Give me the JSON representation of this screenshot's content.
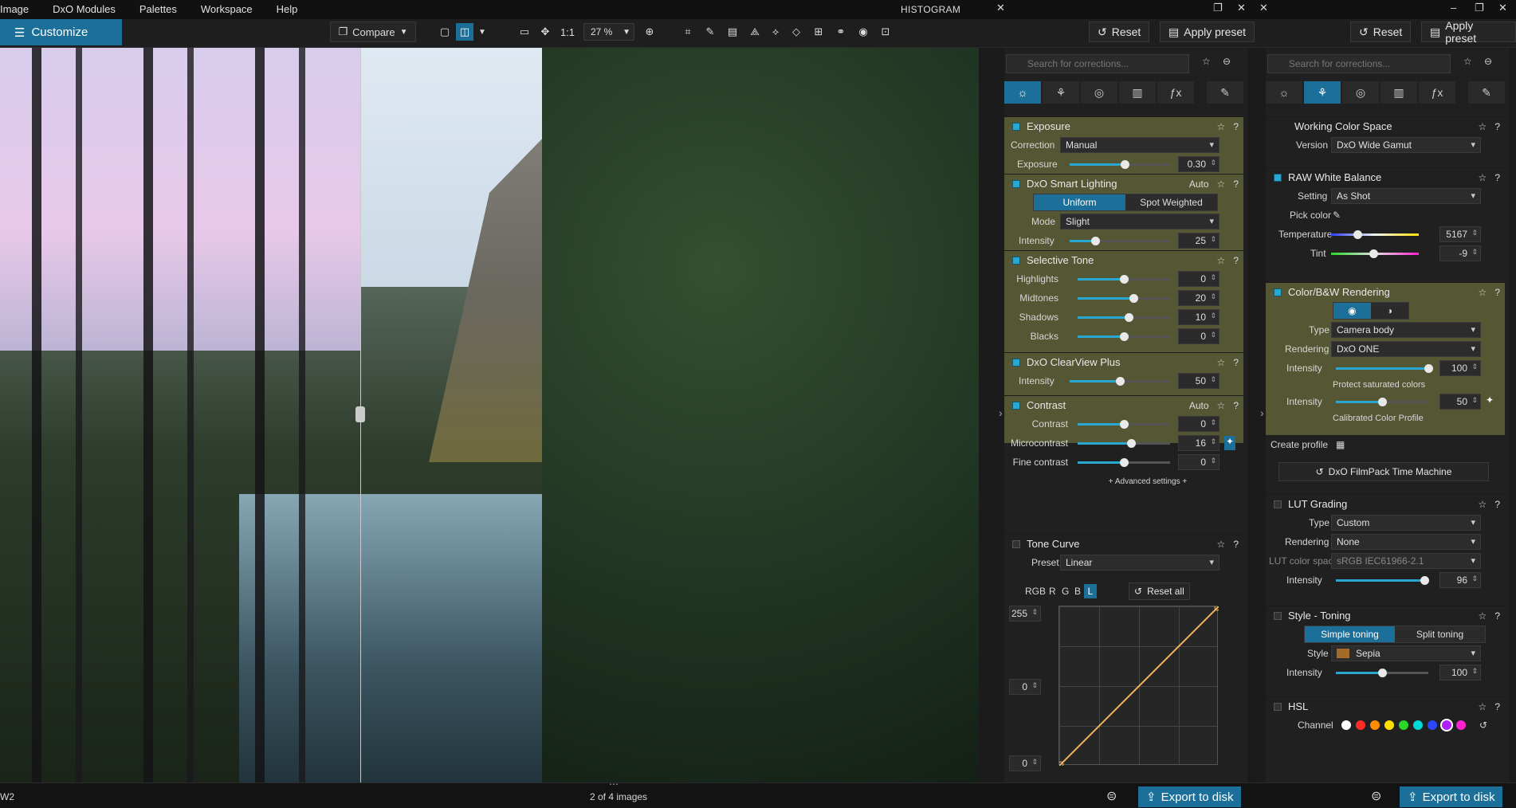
{
  "menu": [
    "Image",
    "DxO Modules",
    "Palettes",
    "Workspace",
    "Help"
  ],
  "histogram_title": "HISTOGRAM",
  "toolbar": {
    "customize": "Customize",
    "compare": "Compare",
    "one_to_one": "1:1",
    "zoom": "27 %",
    "reset": "Reset",
    "apply_preset": "Apply preset"
  },
  "panel1": {
    "search_placeholder": "Search for corrections...",
    "exposure": {
      "title": "Exposure",
      "correction_label": "Correction",
      "correction_value": "Manual",
      "exposure_label": "Exposure",
      "exposure_value": "0.30",
      "exposure_level": 0.55
    },
    "smart_lighting": {
      "title": "DxO Smart Lighting",
      "auto": "Auto",
      "uniform": "Uniform",
      "spot": "Spot Weighted",
      "mode_label": "Mode",
      "mode_value": "Slight",
      "intensity_label": "Intensity",
      "intensity_value": "25",
      "intensity_level": 0.25
    },
    "selective_tone": {
      "title": "Selective Tone",
      "rows": [
        {
          "label": "Highlights",
          "value": "0",
          "level": 0.5
        },
        {
          "label": "Midtones",
          "value": "20",
          "level": 0.6
        },
        {
          "label": "Shadows",
          "value": "10",
          "level": 0.55
        },
        {
          "label": "Blacks",
          "value": "0",
          "level": 0.5
        }
      ]
    },
    "clearview": {
      "title": "DxO ClearView Plus",
      "intensity_label": "Intensity",
      "intensity_value": "50",
      "intensity_level": 0.5
    },
    "contrast": {
      "title": "Contrast",
      "auto": "Auto",
      "rows": [
        {
          "label": "Contrast",
          "value": "0",
          "level": 0.5
        },
        {
          "label": "Microcontrast",
          "value": "16",
          "level": 0.58
        },
        {
          "label": "Fine contrast",
          "value": "0",
          "level": 0.5
        }
      ],
      "advanced": "+ Advanced settings +"
    },
    "tone_curve": {
      "title": "Tone Curve",
      "preset_label": "Preset",
      "preset_value": "Linear",
      "channels": [
        "RGB",
        "R",
        "G",
        "B",
        "L"
      ],
      "active_channel": "L",
      "reset_all": "Reset all",
      "max_val": "255",
      "min_val": "0",
      "bottom_val": "0"
    }
  },
  "panel2": {
    "search_placeholder": "Search for corrections...",
    "working_color_space": {
      "title": "Working Color Space",
      "version_label": "Version",
      "version_value": "DxO Wide Gamut"
    },
    "raw_wb": {
      "title": "RAW White Balance",
      "setting_label": "Setting",
      "setting_value": "As Shot",
      "pick_label": "Pick color",
      "temp_label": "Temperature",
      "temp_value": "5167",
      "temp_level": 0.3,
      "tint_label": "Tint",
      "tint_value": "-9",
      "tint_level": 0.48
    },
    "color_bw": {
      "title": "Color/B&W Rendering",
      "type_label": "Type",
      "type_value": "Camera body",
      "rendering_label": "Rendering",
      "rendering_value": "DxO ONE",
      "intensity_label": "Intensity",
      "intensity_value": "100",
      "intensity_level": 1.0,
      "protect": "Protect saturated colors",
      "protect_intensity_label": "Intensity",
      "protect_intensity_value": "50",
      "protect_level": 0.5,
      "calibrated": "Calibrated Color Profile"
    },
    "create_profile": "Create profile",
    "filmpack": "DxO FilmPack Time Machine",
    "lut": {
      "title": "LUT Grading",
      "type_label": "Type",
      "type_value": "Custom",
      "rendering_label": "Rendering",
      "rendering_value": "None",
      "space_label": "LUT color space",
      "space_value": "sRGB IEC61966-2.1",
      "intensity_label": "Intensity",
      "intensity_value": "96",
      "intensity_level": 0.96
    },
    "toning": {
      "title": "Style - Toning",
      "simple": "Simple toning",
      "split": "Split toning",
      "style_label": "Style",
      "style_value": "Sepia",
      "intensity_label": "Intensity",
      "intensity_value": "100",
      "intensity_level": 0.5
    },
    "hsl": {
      "title": "HSL",
      "channel_label": "Channel",
      "channel_colors": [
        "#ffffff",
        "#ff2a2a",
        "#ff8c00",
        "#ffe000",
        "#2ad62a",
        "#00d8d8",
        "#2a48ff",
        "#b020ff",
        "#ff20d0"
      ]
    }
  },
  "status": {
    "left": "W2",
    "center": "2 of 4 images",
    "export": "Export to disk"
  },
  "colors": {
    "accent": "#1c6f99",
    "active_section": "#555634"
  }
}
